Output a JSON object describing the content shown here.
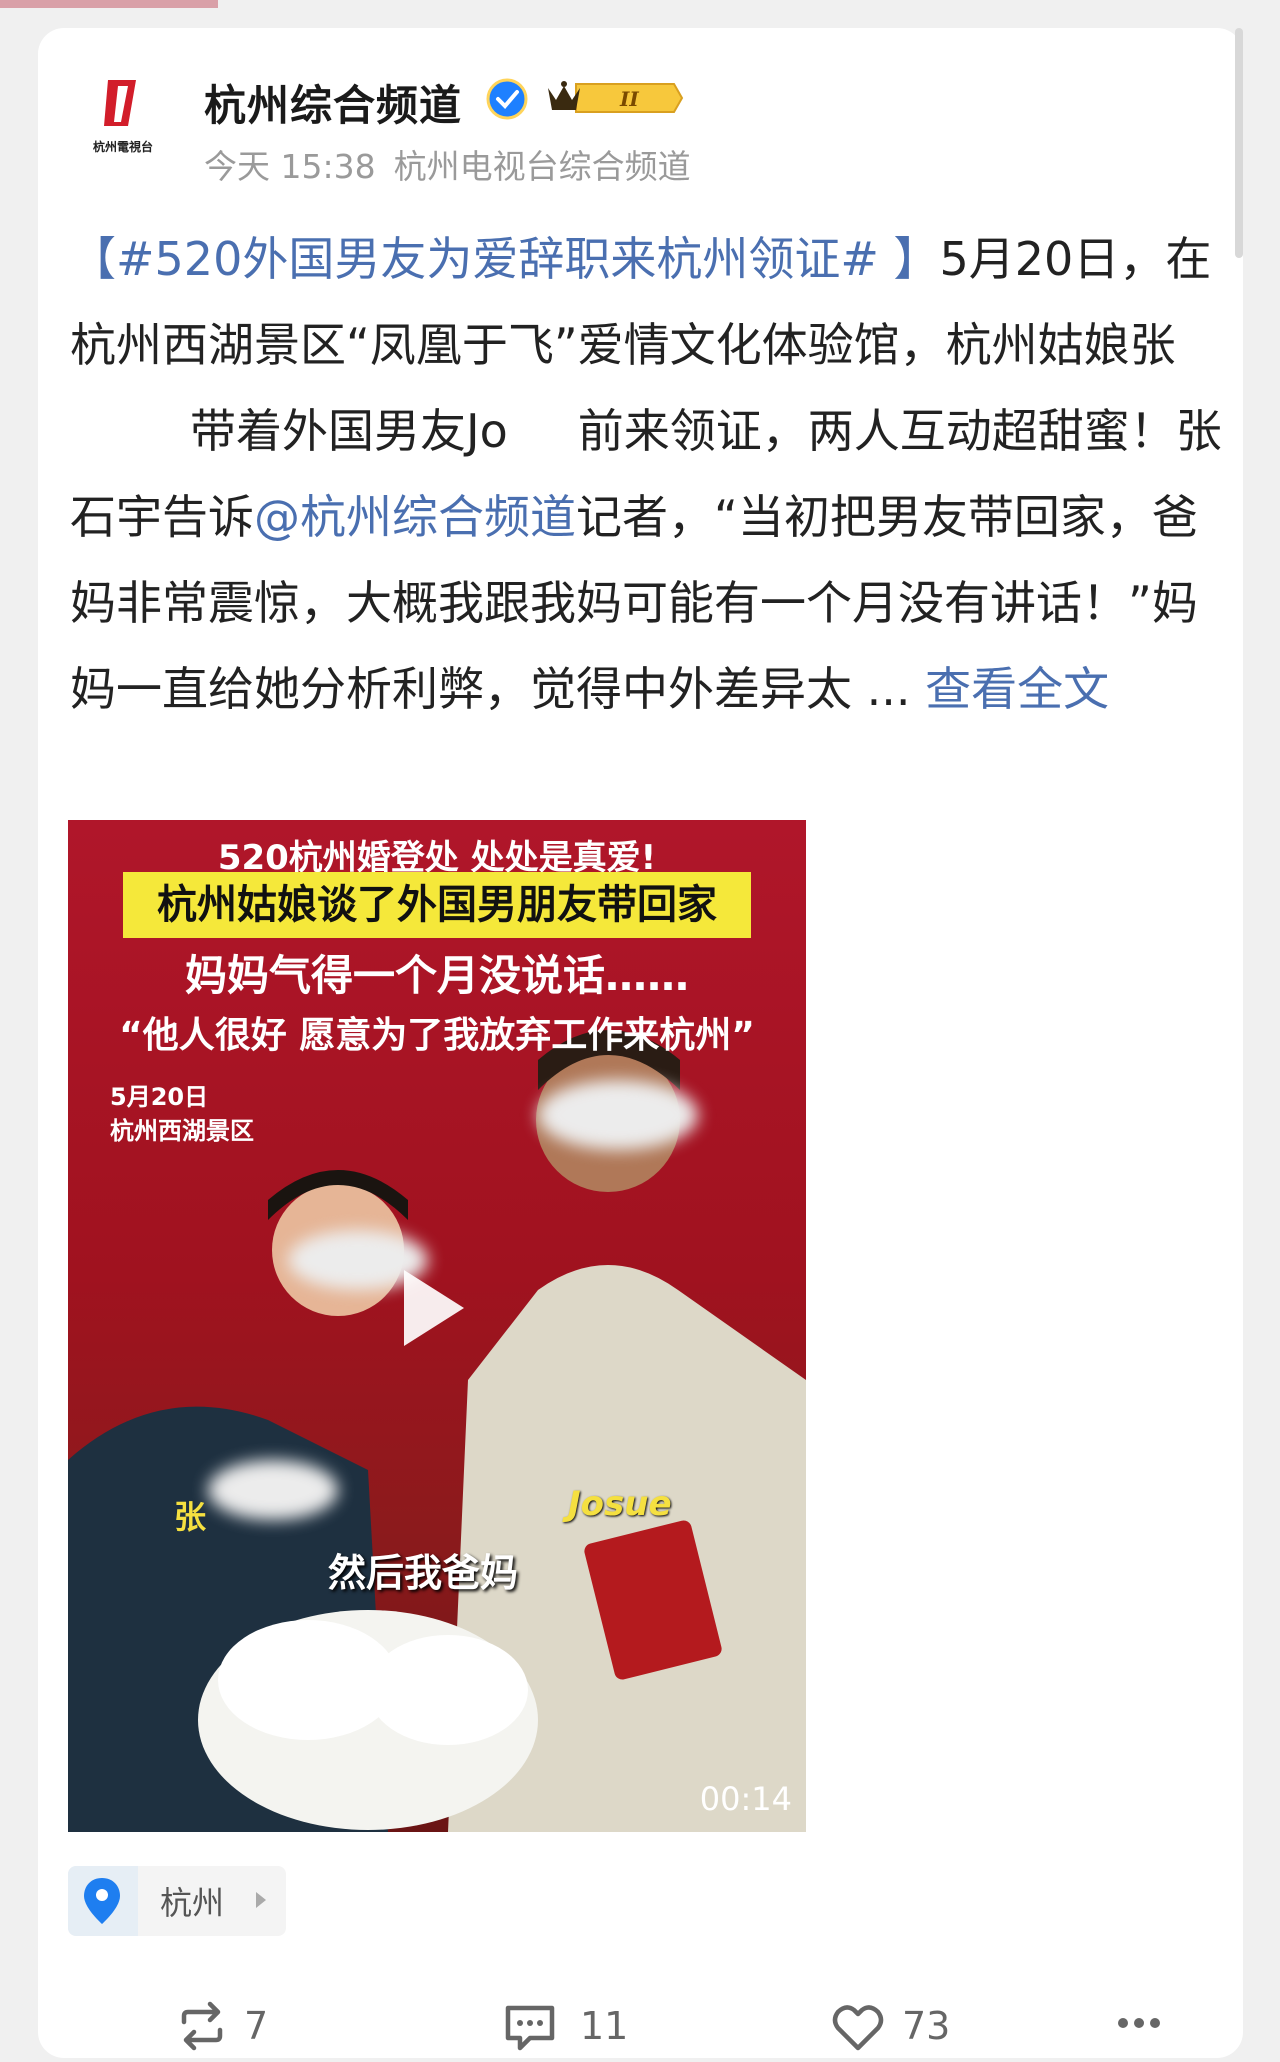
{
  "account": {
    "name": "杭州综合频道",
    "time": "今天 15:38",
    "source": "杭州电视台综合频道",
    "logo_text": "杭州電視台",
    "vip_level": "II"
  },
  "post": {
    "hashtag": "【#520外国男友为爱辞职来杭州领证# 】",
    "text_a": "5月20日，在杭州西湖景区“凤凰于飞”爱情文化体验馆，杭州姑娘张",
    "text_b": "带着外国男友Jo",
    "text_c": "前来领证，两人互动超甜蜜！张石宇告诉",
    "mention": "@杭州综合频道",
    "text_d": "记者，“当初把男友带回家，爸妈非常震惊，大概我跟我妈可能有一个月没有讲话！”妈妈一直给她分析利弊，觉得中外差异太 ...",
    "more_link": "查看全文"
  },
  "video": {
    "title1": "520杭州婚登处 处处是真爱!",
    "title2": "杭州姑娘谈了外国男朋友带回家",
    "title3": "妈妈气得一个月没说话……",
    "title4": "“他人很好 愿意为了我放弃工作来杭州”",
    "date": "5月20日",
    "place": "杭州西湖景区",
    "name_en": "Josue",
    "name_cn": "张",
    "caption": "然后我爸妈",
    "duration": "00:14"
  },
  "location": {
    "label": "杭州"
  },
  "actions": {
    "repost_count": "7",
    "comment_count": "11",
    "like_count": "73"
  },
  "colors": {
    "link": "#4a6fb0",
    "verified": "#1e80ff",
    "background": "#f0f0f0"
  }
}
